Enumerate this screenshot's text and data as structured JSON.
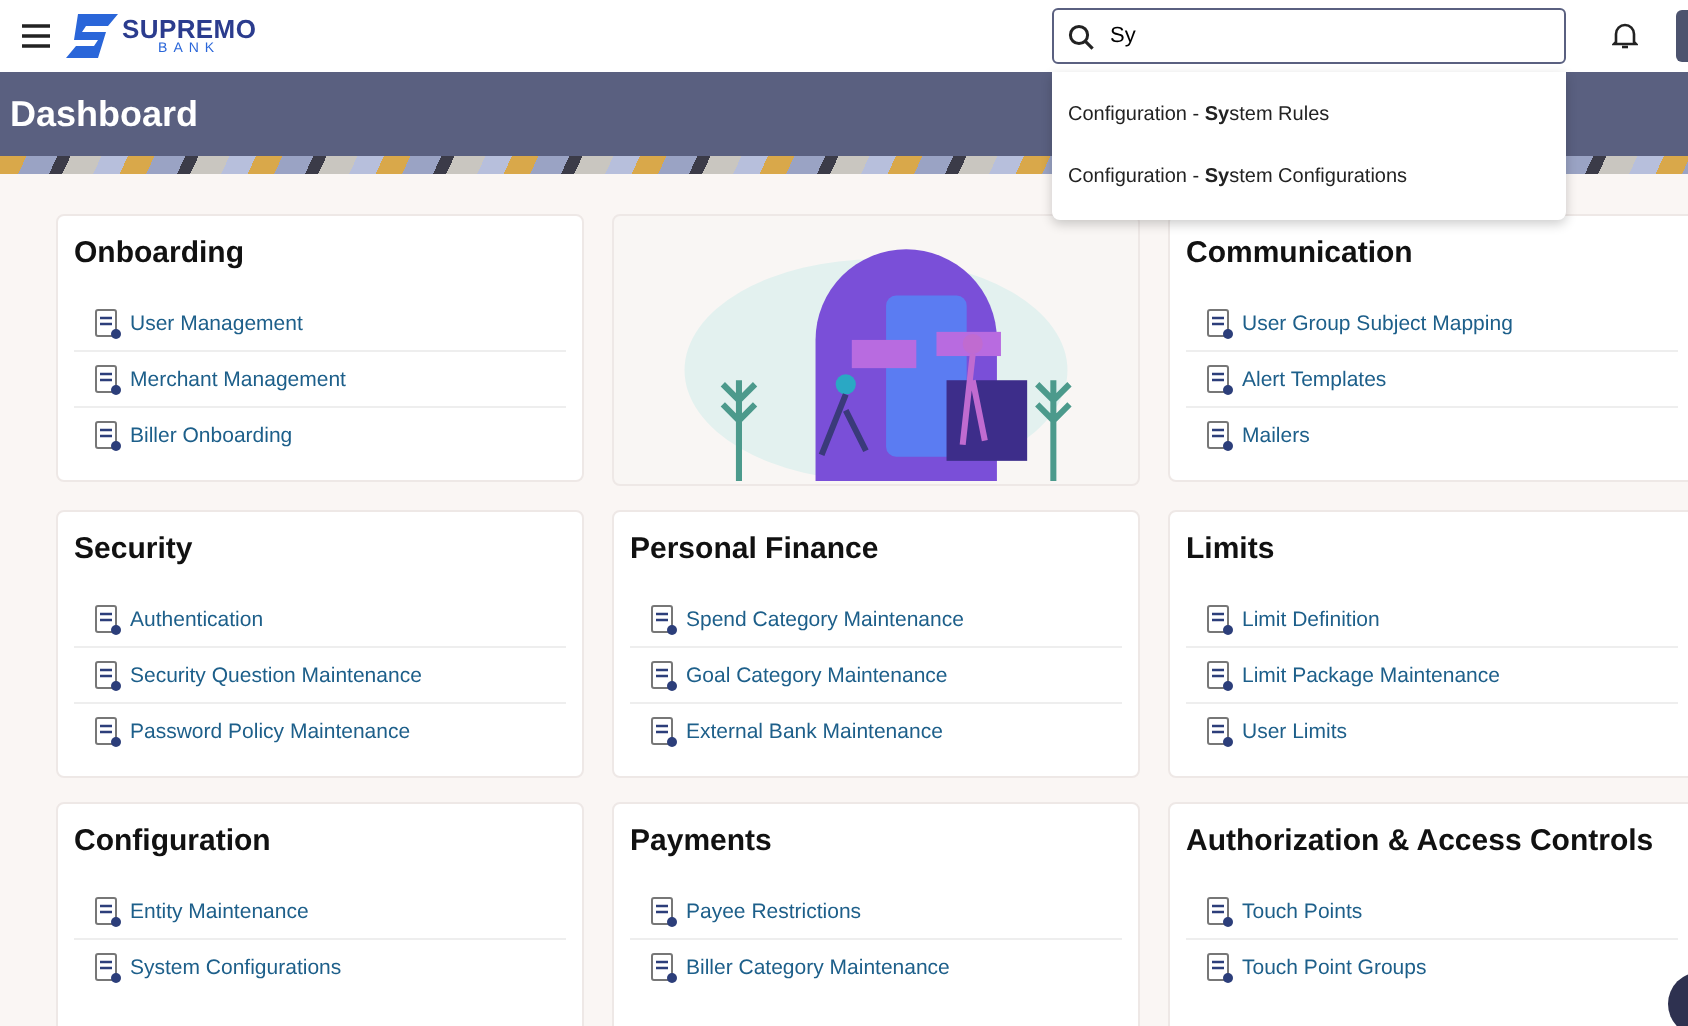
{
  "header": {
    "brand": "SUPREMO",
    "brand_sub": "BANK",
    "search": {
      "value": "Sy"
    },
    "suggestions": [
      "Configuration - **Sy**stem Rules",
      "Configuration - **Sy**stem Configurations"
    ]
  },
  "page_title": "Dashboard",
  "cards": [
    {
      "kind": "links",
      "title": "Onboarding",
      "items": [
        "User Management",
        "Merchant Management",
        "Biller Onboarding"
      ]
    },
    {
      "kind": "illustration"
    },
    {
      "kind": "links",
      "title": "Communication",
      "items": [
        "User Group Subject Mapping",
        "Alert Templates",
        "Mailers"
      ]
    },
    {
      "kind": "links",
      "title": "Security",
      "items": [
        "Authentication",
        "Security Question Maintenance",
        "Password Policy Maintenance"
      ]
    },
    {
      "kind": "links",
      "title": "Personal Finance",
      "items": [
        "Spend Category Maintenance",
        "Goal Category Maintenance",
        "External Bank Maintenance"
      ]
    },
    {
      "kind": "links",
      "title": "Limits",
      "items": [
        "Limit Definition",
        "Limit Package Maintenance",
        "User Limits"
      ]
    },
    {
      "kind": "links",
      "title": "Configuration",
      "items": [
        "Entity Maintenance",
        "System Configurations"
      ]
    },
    {
      "kind": "links",
      "title": "Payments",
      "items": [
        "Payee Restrictions",
        "Biller Category Maintenance"
      ]
    },
    {
      "kind": "links",
      "title": "Authorization & Access Controls",
      "items": [
        "Touch Points",
        "Touch Point Groups"
      ]
    }
  ]
}
